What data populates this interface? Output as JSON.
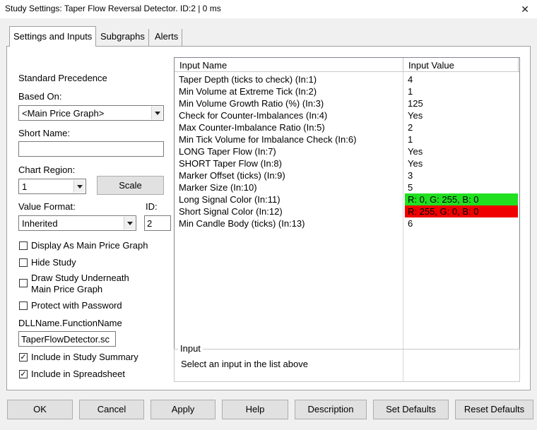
{
  "window": {
    "title": "Study Settings: Taper Flow Reversal Detector. ID:2 | 0 ms"
  },
  "tabs": [
    {
      "label": "Settings and Inputs"
    },
    {
      "label": "Subgraphs"
    },
    {
      "label": "Alerts"
    }
  ],
  "left": {
    "standard_precedence": "Standard Precedence",
    "based_on_label": "Based On:",
    "based_on_value": "<Main Price Graph>",
    "short_name_label": "Short Name:",
    "short_name_value": "",
    "chart_region_label": "Chart Region:",
    "chart_region_value": "1",
    "scale_button": "Scale",
    "value_format_label": "Value Format:",
    "value_format_value": "Inherited",
    "id_label": "ID:",
    "id_value": "2",
    "checkboxes": [
      {
        "label": "Display As Main Price Graph",
        "checked": false
      },
      {
        "label": "Hide Study",
        "checked": false
      },
      {
        "label": "Draw Study Underneath",
        "label2": "Main Price Graph",
        "checked": false
      },
      {
        "label": "Protect with Password",
        "checked": false
      }
    ],
    "dll_label": "DLLName.FunctionName",
    "dll_value": "TaperFlowDetector.sc",
    "summary_checks": [
      {
        "label": "Include in Study Summary",
        "checked": true
      },
      {
        "label": "Include in Spreadsheet",
        "checked": true
      }
    ]
  },
  "grid": {
    "col_name": "Input Name",
    "col_value": "Input Value",
    "rows": [
      {
        "name": "Taper Depth (ticks to check)  (In:1)",
        "value": "4"
      },
      {
        "name": "Min Volume at Extreme Tick  (In:2)",
        "value": "1"
      },
      {
        "name": "Min Volume Growth Ratio (%)  (In:3)",
        "value": "125"
      },
      {
        "name": "Check for Counter-Imbalances  (In:4)",
        "value": "Yes"
      },
      {
        "name": "Max Counter-Imbalance Ratio  (In:5)",
        "value": "2"
      },
      {
        "name": "Min Tick Volume for Imbalance Check  (In:6)",
        "value": "1"
      },
      {
        "name": "LONG Taper Flow  (In:7)",
        "value": "Yes"
      },
      {
        "name": "SHORT Taper Flow  (In:8)",
        "value": "Yes"
      },
      {
        "name": "Marker Offset (ticks)  (In:9)",
        "value": "3"
      },
      {
        "name": "Marker Size  (In:10)",
        "value": "5"
      },
      {
        "name": "Long Signal Color  (In:11)",
        "value": "R: 0, G: 255, B: 0",
        "color": "#20e020"
      },
      {
        "name": "Short Signal Color  (In:12)",
        "value": "R: 255, G: 0, B: 0",
        "color": "#f00000"
      },
      {
        "name": "Min Candle Body (ticks)  (In:13)",
        "value": "6"
      }
    ]
  },
  "input_group": {
    "title": "Input",
    "text": "Select an input in the list above"
  },
  "buttons": {
    "ok": "OK",
    "cancel": "Cancel",
    "apply": "Apply",
    "help": "Help",
    "description": "Description",
    "set_defaults": "Set Defaults",
    "reset_defaults": "Reset Defaults"
  }
}
